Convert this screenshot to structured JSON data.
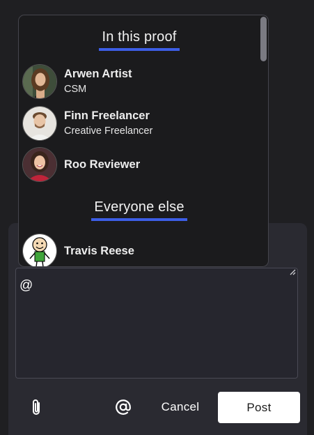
{
  "mention_dropdown": {
    "sections": [
      {
        "title": "In this proof"
      },
      {
        "title": "Everyone else"
      }
    ],
    "users": [
      {
        "name": "Arwen Artist",
        "role": "CSM"
      },
      {
        "name": "Finn Freelancer",
        "role": "Creative Freelancer"
      },
      {
        "name": "Roo Reviewer",
        "role": ""
      },
      {
        "name": "Travis Reese",
        "role": ""
      }
    ]
  },
  "composer": {
    "text_value": "@",
    "attach_icon": "paperclip-icon",
    "mention_icon": "at-sign-icon",
    "cancel_label": "Cancel",
    "post_label": "Post"
  },
  "colors": {
    "accent": "#3d5ee6",
    "background": "#1f1f22",
    "dropdown_bg": "#1b1b1d",
    "composer_bg": "#2a2a31"
  }
}
